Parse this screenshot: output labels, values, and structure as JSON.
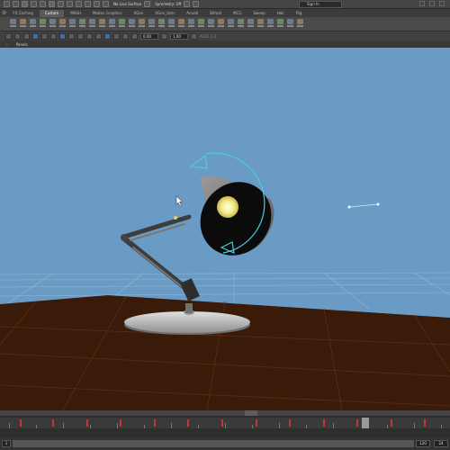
{
  "status_line": {
    "mode_text": "No Live Surface",
    "symmetry_text": "Symmetry: Off",
    "sign_in": "Sign In"
  },
  "shelf_tabs": [
    "FX Caching",
    "Custom",
    "MASH",
    "Motion Graphics",
    "XGen",
    "XGen_User",
    "Arnold",
    "Bifrost",
    "MCG",
    "Sweep",
    "Hair",
    "Rig"
  ],
  "shelf_tab_active": 1,
  "toolbar2": {
    "field_a": "0.00",
    "field_b": "1.00",
    "color_space": "ACES 1.0"
  },
  "panel_menu": {
    "panels": "Panels"
  },
  "timeline": {
    "start_field": "1",
    "end_field": "24",
    "current_frame": "120"
  },
  "colors": {
    "viewport_bg": "#6a9bc5",
    "floor": "#3a1a08",
    "manipulator": "#4ec9e6"
  },
  "icons": {
    "new_scene": "file-icon",
    "open": "folder-icon",
    "save": "save-icon",
    "select": "arrow-icon",
    "move": "move-icon",
    "rotate": "rotate-icon",
    "scale": "scale-icon",
    "snap": "magnet-icon",
    "render": "clapper-icon",
    "settings": "gear-icon"
  }
}
